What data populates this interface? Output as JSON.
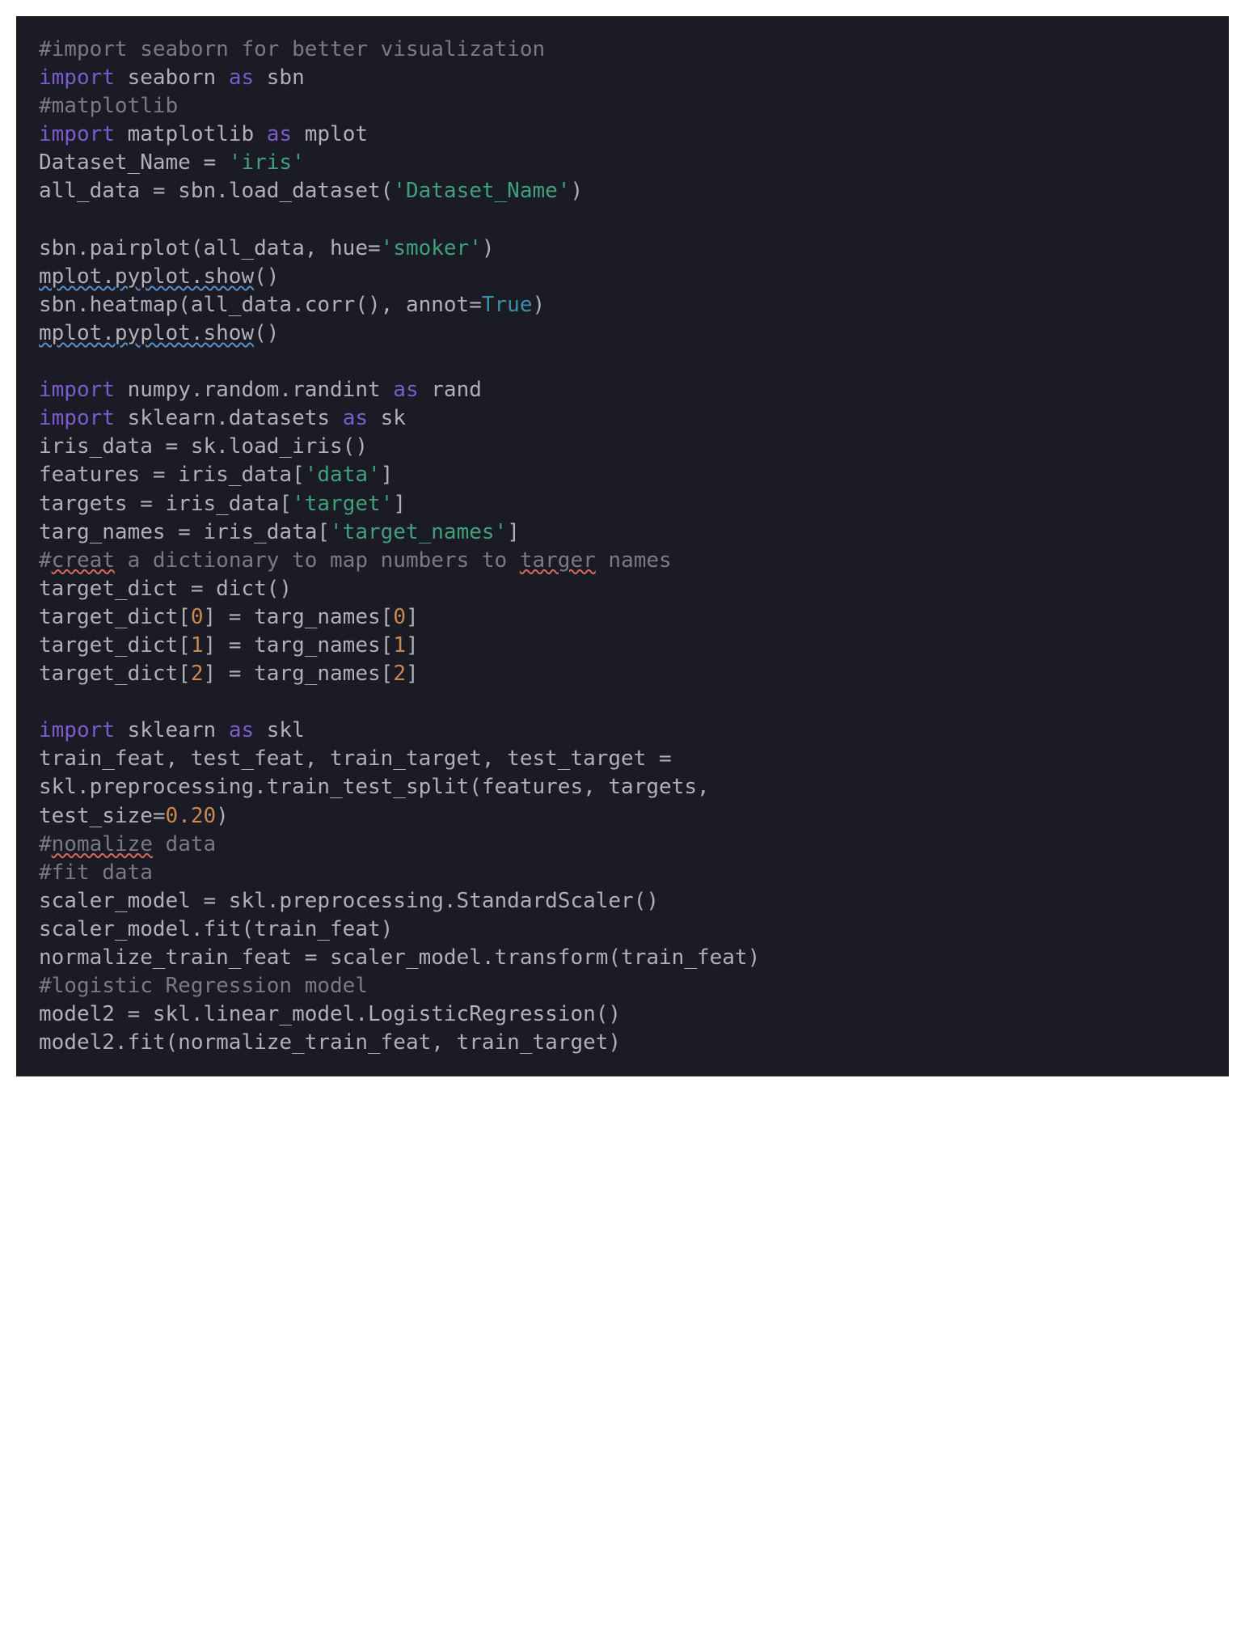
{
  "tokens": [
    [
      {
        "t": "#import seaborn for better visualization",
        "c": "c-comment"
      }
    ],
    [
      {
        "t": "import",
        "c": "c-keyword"
      },
      {
        "t": " seaborn ",
        "c": "c-plain"
      },
      {
        "t": "as",
        "c": "c-keyword"
      },
      {
        "t": " sbn",
        "c": "c-plain"
      }
    ],
    [
      {
        "t": "#matplotlib",
        "c": "c-comment"
      }
    ],
    [
      {
        "t": "import",
        "c": "c-keyword"
      },
      {
        "t": " matplotlib ",
        "c": "c-plain"
      },
      {
        "t": "as",
        "c": "c-keyword"
      },
      {
        "t": " mplot",
        "c": "c-plain"
      }
    ],
    [
      {
        "t": "Dataset_Name = ",
        "c": "c-plain"
      },
      {
        "t": "'iris'",
        "c": "c-string"
      }
    ],
    [
      {
        "t": "all_data = sbn.load_dataset(",
        "c": "c-plain"
      },
      {
        "t": "'Dataset_Name'",
        "c": "c-string"
      },
      {
        "t": ")",
        "c": "c-plain"
      }
    ],
    [
      {
        "t": "",
        "c": "c-plain"
      }
    ],
    [
      {
        "t": "sbn.pairplot(all_data, hue=",
        "c": "c-plain"
      },
      {
        "t": "'smoker'",
        "c": "c-string"
      },
      {
        "t": ")",
        "c": "c-plain"
      }
    ],
    [
      {
        "t": "mplot.pyplot.show",
        "c": "c-plain squiggle-warn"
      },
      {
        "t": "()",
        "c": "c-plain"
      }
    ],
    [
      {
        "t": "sbn.heatmap(all_data.corr(), annot=",
        "c": "c-plain"
      },
      {
        "t": "True",
        "c": "c-keyword2"
      },
      {
        "t": ")",
        "c": "c-plain"
      }
    ],
    [
      {
        "t": "mplot.pyplot.show",
        "c": "c-plain squiggle-warn"
      },
      {
        "t": "()",
        "c": "c-plain"
      }
    ],
    [
      {
        "t": "",
        "c": "c-plain"
      }
    ],
    [
      {
        "t": "import",
        "c": "c-keyword"
      },
      {
        "t": " numpy.random.randint ",
        "c": "c-plain"
      },
      {
        "t": "as",
        "c": "c-keyword"
      },
      {
        "t": " rand",
        "c": "c-plain"
      }
    ],
    [
      {
        "t": "import",
        "c": "c-keyword"
      },
      {
        "t": " sklearn.datasets ",
        "c": "c-plain"
      },
      {
        "t": "as",
        "c": "c-keyword"
      },
      {
        "t": " sk",
        "c": "c-plain"
      }
    ],
    [
      {
        "t": "iris_data = sk.load_iris()",
        "c": "c-plain"
      }
    ],
    [
      {
        "t": "features = iris_data[",
        "c": "c-plain"
      },
      {
        "t": "'data'",
        "c": "c-string"
      },
      {
        "t": "]",
        "c": "c-plain"
      }
    ],
    [
      {
        "t": "targets = iris_data[",
        "c": "c-plain"
      },
      {
        "t": "'target'",
        "c": "c-string"
      },
      {
        "t": "]",
        "c": "c-plain"
      }
    ],
    [
      {
        "t": "targ_names = iris_data[",
        "c": "c-plain"
      },
      {
        "t": "'target_names'",
        "c": "c-string"
      },
      {
        "t": "]",
        "c": "c-plain"
      }
    ],
    [
      {
        "t": "#",
        "c": "c-comment"
      },
      {
        "t": "creat",
        "c": "c-comment squiggle-spell"
      },
      {
        "t": " a dictionary to map numbers to ",
        "c": "c-comment"
      },
      {
        "t": "targer",
        "c": "c-comment squiggle-spell"
      },
      {
        "t": " names",
        "c": "c-comment"
      }
    ],
    [
      {
        "t": "target_dict = dict()",
        "c": "c-plain"
      }
    ],
    [
      {
        "t": "target_dict[",
        "c": "c-plain"
      },
      {
        "t": "0",
        "c": "c-number"
      },
      {
        "t": "] = targ_names[",
        "c": "c-plain"
      },
      {
        "t": "0",
        "c": "c-number"
      },
      {
        "t": "]",
        "c": "c-plain"
      }
    ],
    [
      {
        "t": "target_dict[",
        "c": "c-plain"
      },
      {
        "t": "1",
        "c": "c-number"
      },
      {
        "t": "] = targ_names[",
        "c": "c-plain"
      },
      {
        "t": "1",
        "c": "c-number"
      },
      {
        "t": "]",
        "c": "c-plain"
      }
    ],
    [
      {
        "t": "target_dict[",
        "c": "c-plain"
      },
      {
        "t": "2",
        "c": "c-number"
      },
      {
        "t": "] = targ_names[",
        "c": "c-plain"
      },
      {
        "t": "2",
        "c": "c-number"
      },
      {
        "t": "]",
        "c": "c-plain"
      }
    ],
    [
      {
        "t": "",
        "c": "c-plain"
      }
    ],
    [
      {
        "t": "import",
        "c": "c-keyword"
      },
      {
        "t": " sklearn ",
        "c": "c-plain"
      },
      {
        "t": "as",
        "c": "c-keyword"
      },
      {
        "t": " skl",
        "c": "c-plain"
      }
    ],
    [
      {
        "t": "train_feat, test_feat, train_target, test_target = ",
        "c": "c-plain"
      }
    ],
    [
      {
        "t": "skl.preprocessing.train_test_split(features, targets, ",
        "c": "c-plain"
      }
    ],
    [
      {
        "t": "test_size=",
        "c": "c-plain"
      },
      {
        "t": "0.20",
        "c": "c-number"
      },
      {
        "t": ")",
        "c": "c-plain"
      }
    ],
    [
      {
        "t": "#",
        "c": "c-comment"
      },
      {
        "t": "nomalize",
        "c": "c-comment squiggle-spell"
      },
      {
        "t": " data",
        "c": "c-comment"
      }
    ],
    [
      {
        "t": "#fit data",
        "c": "c-comment"
      }
    ],
    [
      {
        "t": "scaler_model = skl.preprocessing.StandardScaler()",
        "c": "c-plain"
      }
    ],
    [
      {
        "t": "scaler_model.fit(train_feat)",
        "c": "c-plain"
      }
    ],
    [
      {
        "t": "normalize_train_feat = scaler_model.transform(train_feat)",
        "c": "c-plain"
      }
    ],
    [
      {
        "t": "#logistic Regression model",
        "c": "c-comment"
      }
    ],
    [
      {
        "t": "model2 = skl.linear_model.LogisticRegression()",
        "c": "c-plain"
      }
    ],
    [
      {
        "t": "model2.fit(normalize_train_feat, train_target)",
        "c": "c-plain"
      }
    ]
  ]
}
